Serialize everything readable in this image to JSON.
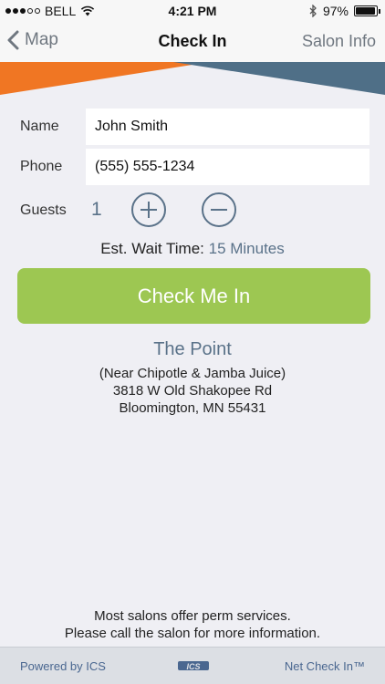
{
  "status_bar": {
    "carrier": "BELL",
    "time": "4:21 PM",
    "battery": "97%",
    "battery_level": 0.97
  },
  "nav": {
    "back_label": "Map",
    "title": "Check In",
    "right_label": "Salon Info"
  },
  "colors": {
    "accent_orange": "#f07623",
    "accent_slate": "#4f6f87",
    "button_green": "#9dc752",
    "text_blue": "#5a7289"
  },
  "form": {
    "name_label": "Name",
    "name_value": "John Smith",
    "phone_label": "Phone",
    "phone_value": "(555) 555-1234",
    "guests_label": "Guests",
    "guests_count": "1"
  },
  "wait": {
    "label": "Est. Wait Time:",
    "value": "15 Minutes"
  },
  "checkin_button": "Check Me In",
  "salon": {
    "name": "The Point",
    "address_lines": [
      "(Near Chipotle & Jamba Juice)",
      "3818 W Old Shakopee Rd",
      "Bloomington, MN 55431"
    ]
  },
  "note_lines": [
    "Most salons offer perm services.",
    "Please call the salon for more information."
  ],
  "footer": {
    "left": "Powered by ICS",
    "logo_text": "ICS",
    "right": "Net Check In™"
  }
}
